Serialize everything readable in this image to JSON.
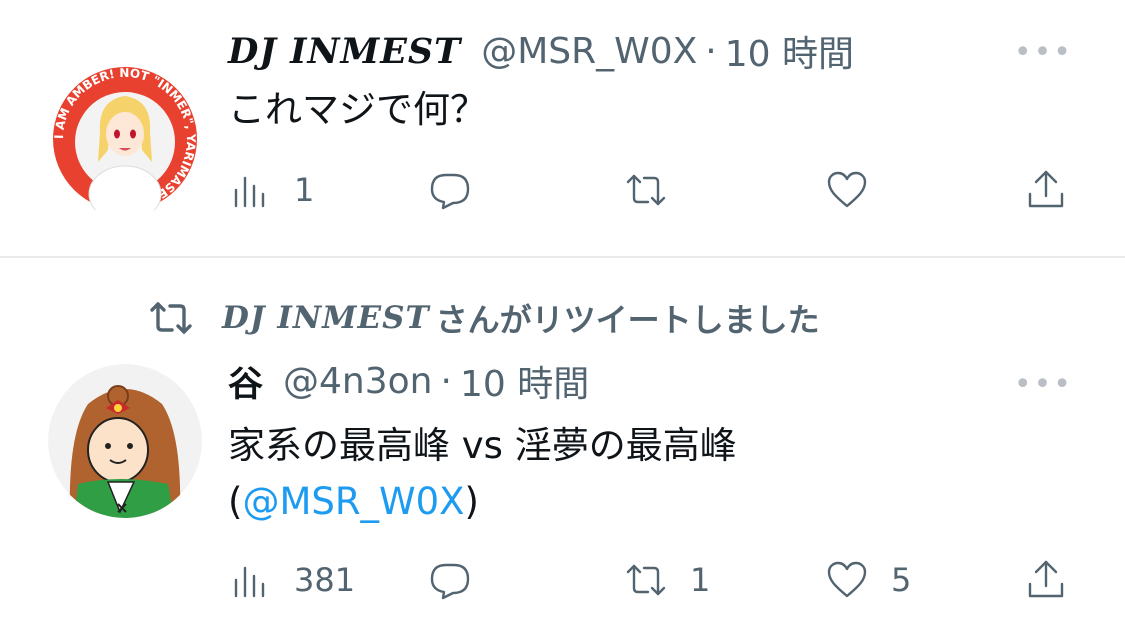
{
  "tweets": [
    {
      "display_name": "DJ INMEST",
      "handle": "@MSR_W0X",
      "separator": "·",
      "time": "10 時間",
      "more": "•••",
      "text": "これマジで何？",
      "avatar_ring_text": "I AM AMBER! NOT \"INMER\", YARIMASENEE!",
      "stats": {
        "views": "1",
        "replies": "",
        "retweets": "",
        "likes": ""
      }
    },
    {
      "retweeted_by_name": "DJ INMEST",
      "retweeted_by_suffix": "さんがリツイートしました",
      "display_name": "谷",
      "handle": "@4n3on",
      "separator": "·",
      "time": "10 時間",
      "more": "•••",
      "text_line1": "家系の最高峰 vs 淫夢の最高峰",
      "text_line2_open": "(",
      "text_line2_mention": "@MSR_W0X",
      "text_line2_close": ")",
      "stats": {
        "views": "381",
        "replies": "",
        "retweets": "1",
        "likes": "5"
      }
    }
  ],
  "icons": {
    "views": "bar-chart-icon",
    "reply": "speech-bubble-icon",
    "retweet": "retweet-icon",
    "like": "heart-icon",
    "share": "share-icon"
  },
  "colors": {
    "text_primary": "#0f1419",
    "text_secondary": "#536471",
    "mention": "#1d9bf0",
    "divider": "#e7e9eb",
    "avatar1_bg": "#e8412f"
  }
}
